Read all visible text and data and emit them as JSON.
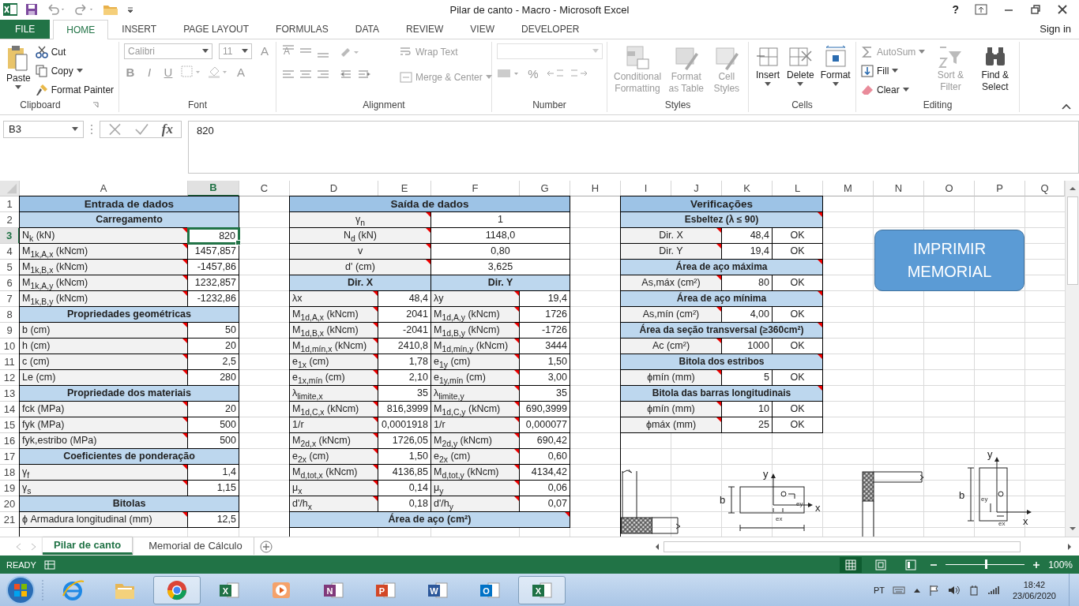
{
  "window": {
    "title": "Pilar de canto - Macro - Microsoft Excel",
    "help": "?"
  },
  "tabs": [
    {
      "label": "FILE",
      "kind": "file",
      "selected": false
    },
    {
      "label": "HOME",
      "kind": "tab",
      "selected": true
    },
    {
      "label": "INSERT",
      "kind": "tab",
      "selected": false
    },
    {
      "label": "PAGE LAYOUT",
      "kind": "tab",
      "selected": false
    },
    {
      "label": "FORMULAS",
      "kind": "tab",
      "selected": false
    },
    {
      "label": "DATA",
      "kind": "tab",
      "selected": false
    },
    {
      "label": "REVIEW",
      "kind": "tab",
      "selected": false
    },
    {
      "label": "VIEW",
      "kind": "tab",
      "selected": false
    },
    {
      "label": "DEVELOPER",
      "kind": "tab",
      "selected": false
    }
  ],
  "sign_in": "Sign in",
  "ribbon": {
    "clipboard": {
      "title": "Clipboard",
      "paste": "Paste",
      "cut": "Cut",
      "copy": "Copy",
      "format_painter": "Format Painter"
    },
    "font": {
      "title": "Font",
      "family": "Calibri",
      "size": "11",
      "bold": "B",
      "italic": "I",
      "underline": "U",
      "grow": "A",
      "shrink": "A",
      "paint_letter": "A",
      "disabled": true
    },
    "alignment": {
      "title": "Alignment",
      "wrap_text": "Wrap Text",
      "merge_center": "Merge & Center",
      "disabled": true
    },
    "number": {
      "title": "Number",
      "percent": "%",
      "disabled": true
    },
    "styles": {
      "title": "Styles",
      "conditional": "Conditional Formatting",
      "format_table": "Format as Table",
      "cell_styles": "Cell Styles",
      "disabled": true
    },
    "cells": {
      "title": "Cells",
      "insert": "Insert",
      "delete": "Delete",
      "format": "Format"
    },
    "editing": {
      "title": "Editing",
      "autosum": {
        "label": "AutoSum",
        "disabled": true
      },
      "fill": {
        "label": "Fill",
        "disabled": false
      },
      "clear": {
        "label": "Clear",
        "disabled": false
      },
      "sort_filter": {
        "label": "Sort & Filter",
        "disabled": true
      },
      "find_select": {
        "label": "Find & Select",
        "disabled": false
      }
    }
  },
  "formula_bar": {
    "name_box": "B3",
    "function_label": "fx",
    "value": "820"
  },
  "sheet": {
    "columns": [
      {
        "label": "A",
        "selected": false
      },
      {
        "label": "B",
        "selected": true
      },
      {
        "label": "C",
        "selected": false
      },
      {
        "label": "D",
        "selected": false
      },
      {
        "label": "E",
        "selected": false
      },
      {
        "label": "F",
        "selected": false
      },
      {
        "label": "G",
        "selected": false
      },
      {
        "label": "H",
        "selected": false
      },
      {
        "label": "I",
        "selected": false
      },
      {
        "label": "J",
        "selected": false
      },
      {
        "label": "K",
        "selected": false
      },
      {
        "label": "L",
        "selected": false
      },
      {
        "label": "M",
        "selected": false
      },
      {
        "label": "N",
        "selected": false
      },
      {
        "label": "O",
        "selected": false
      },
      {
        "label": "P",
        "selected": false
      },
      {
        "label": "Q",
        "selected": false
      }
    ],
    "rows": [
      {
        "label": "1",
        "selected": false
      },
      {
        "label": "2",
        "selected": false
      },
      {
        "label": "3",
        "selected": true
      },
      {
        "label": "4",
        "selected": false
      },
      {
        "label": "5",
        "selected": false
      },
      {
        "label": "6",
        "selected": false
      },
      {
        "label": "7",
        "selected": false
      },
      {
        "label": "8",
        "selected": false
      },
      {
        "label": "9",
        "selected": false
      },
      {
        "label": "10",
        "selected": false
      },
      {
        "label": "11",
        "selected": false
      },
      {
        "label": "12",
        "selected": false
      },
      {
        "label": "13",
        "selected": false
      },
      {
        "label": "14",
        "selected": false
      },
      {
        "label": "15",
        "selected": false
      },
      {
        "label": "16",
        "selected": false
      },
      {
        "label": "17",
        "selected": false
      },
      {
        "label": "18",
        "selected": false
      },
      {
        "label": "19",
        "selected": false
      },
      {
        "label": "20",
        "selected": false
      },
      {
        "label": "21",
        "selected": false
      }
    ]
  },
  "input": {
    "rows": [
      {
        "kind": "title",
        "text": "Entrada de dados"
      },
      {
        "kind": "section",
        "text": "Carregamento"
      },
      {
        "kind": "pair",
        "label": "N$_{k}$ (kN)",
        "value": "820",
        "note": true,
        "selected": true
      },
      {
        "kind": "pair",
        "label": "M$_{1k,A,x}$ (kNcm)",
        "value": "1457,857",
        "note": true,
        "selected": false
      },
      {
        "kind": "pair",
        "label": "M$_{1k,B,x}$ (kNcm)",
        "value": "-1457,86",
        "note": true,
        "selected": false
      },
      {
        "kind": "pair",
        "label": "M$_{1k,A,y}$ (kNcm)",
        "value": "1232,857",
        "note": true,
        "selected": false
      },
      {
        "kind": "pair",
        "label": "M$_{1k,B,y}$ (kNcm)",
        "value": "-1232,86",
        "note": true,
        "selected": false
      },
      {
        "kind": "section",
        "text": "Propriedades geométricas"
      },
      {
        "kind": "pair",
        "label": "b (cm)",
        "value": "50",
        "note": true,
        "selected": false
      },
      {
        "kind": "pair",
        "label": "h (cm)",
        "value": "20",
        "note": true,
        "selected": false
      },
      {
        "kind": "pair",
        "label": "c (cm)",
        "value": "2,5",
        "note": true,
        "selected": false
      },
      {
        "kind": "pair",
        "label": "Le (cm)",
        "value": "280",
        "note": true,
        "selected": false
      },
      {
        "kind": "section",
        "text": "Propriedade dos materiais"
      },
      {
        "kind": "pair",
        "label": "fck (MPa)",
        "value": "20",
        "note": true,
        "selected": false
      },
      {
        "kind": "pair",
        "label": "fyk (MPa)",
        "value": "500",
        "note": true,
        "selected": false
      },
      {
        "kind": "pair",
        "label": "fyk,estribo (MPa)",
        "value": "500",
        "note": true,
        "selected": false
      },
      {
        "kind": "section",
        "text": "Coeficientes de ponderação"
      },
      {
        "kind": "pair",
        "label": "γ$_{f}$",
        "value": "1,4",
        "note": true,
        "selected": false
      },
      {
        "kind": "pair",
        "label": "γ$_{s}$",
        "value": "1,15",
        "note": true,
        "selected": false
      },
      {
        "kind": "section",
        "text": "Bitolas"
      },
      {
        "kind": "pair",
        "label": "ϕ Armadura longitudinal (mm)",
        "value": "12,5",
        "note": true,
        "selected": false
      }
    ]
  },
  "output": {
    "rows": [
      {
        "kind": "title",
        "text": "Saída de dados"
      },
      {
        "kind": "pair",
        "label": "γ$_{n}$",
        "value": "1",
        "note": true
      },
      {
        "kind": "pair",
        "label": "N$_{d}$ (kN)",
        "value": "1148,0",
        "note": true
      },
      {
        "kind": "pair",
        "label": "v",
        "value": "0,80",
        "note": true
      },
      {
        "kind": "pair",
        "label": "d' (cm)",
        "value": "3,625",
        "note": true
      },
      {
        "kind": "heads",
        "labels": [
          "Dir. X",
          "Dir. Y"
        ]
      },
      {
        "kind": "quad",
        "left": {
          "label": "λx",
          "value": "48,4",
          "note": true
        },
        "right": {
          "label": "λy",
          "value": "19,4",
          "note": true
        }
      },
      {
        "kind": "quad",
        "left": {
          "label": "M$_{1d,A,x}$ (kNcm)",
          "value": "2041",
          "note": true
        },
        "right": {
          "label": "M$_{1d,A,y}$ (kNcm)",
          "value": "1726",
          "note": true
        }
      },
      {
        "kind": "quad",
        "left": {
          "label": "M$_{1d,B,x}$ (kNcm)",
          "value": "-2041",
          "note": true
        },
        "right": {
          "label": "M$_{1d,B,y}$ (kNcm)",
          "value": "-1726",
          "note": true
        }
      },
      {
        "kind": "quad",
        "left": {
          "label": "M$_{1d,mín,x}$ (kNcm)",
          "value": "2410,8",
          "note": true
        },
        "right": {
          "label": "M$_{1d,mín,y}$ (kNcm)",
          "value": "3444",
          "note": true
        }
      },
      {
        "kind": "quad",
        "left": {
          "label": "e$_{1x}$ (cm)",
          "value": "1,78",
          "note": true
        },
        "right": {
          "label": "e$_{1y}$ (cm)",
          "value": "1,50",
          "note": true
        }
      },
      {
        "kind": "quad",
        "left": {
          "label": "e$_{1x,mín}$ (cm)",
          "value": "2,10",
          "note": true
        },
        "right": {
          "label": "e$_{1y,mín}$ (cm)",
          "value": "3,00",
          "note": true
        }
      },
      {
        "kind": "quad",
        "left": {
          "label": "λ$_{limite,x}$",
          "value": "35",
          "note": true
        },
        "right": {
          "label": "λ$_{limite,y}$",
          "value": "35",
          "note": true
        }
      },
      {
        "kind": "quad",
        "left": {
          "label": "M$_{1d,C,x}$ (kNcm)",
          "value": "816,3999",
          "note": true
        },
        "right": {
          "label": "M$_{1d,C,y}$ (kNcm)",
          "value": "690,3999",
          "note": true
        }
      },
      {
        "kind": "quad",
        "left": {
          "label": "1/r",
          "value": "0,0001918",
          "note": true
        },
        "right": {
          "label": "1/r",
          "value": "0,000077",
          "note": true
        }
      },
      {
        "kind": "quad",
        "left": {
          "label": "M$_{2d,x}$ (kNcm)",
          "value": "1726,05",
          "note": true
        },
        "right": {
          "label": "M$_{2d,y}$ (kNcm)",
          "value": "690,42",
          "note": true
        }
      },
      {
        "kind": "quad",
        "left": {
          "label": "e$_{2x}$ (cm)",
          "value": "1,50",
          "note": true
        },
        "right": {
          "label": "e$_{2x}$ (cm)",
          "value": "0,60",
          "note": true
        }
      },
      {
        "kind": "quad",
        "left": {
          "label": "M$_{d,tot,x}$ (kNcm)",
          "value": "4136,85",
          "note": true
        },
        "right": {
          "label": "M$_{d,tot,y}$ (kNcm)",
          "value": "4134,42",
          "note": true
        }
      },
      {
        "kind": "quad",
        "left": {
          "label": "μ$_{x}$",
          "value": "0,14",
          "note": true
        },
        "right": {
          "label": "μ$_{y}$",
          "value": "0,06",
          "note": true
        }
      },
      {
        "kind": "quad",
        "left": {
          "label": "d'/h$_{x}$",
          "value": "0,18",
          "note": true
        },
        "right": {
          "label": "d'/h$_{y}$",
          "value": "0,07",
          "note": true
        }
      },
      {
        "kind": "section",
        "text": "Área de aço (cm²)",
        "note": true
      }
    ]
  },
  "checks": {
    "rows": [
      {
        "kind": "title",
        "text": "Verificações"
      },
      {
        "kind": "section",
        "text": "Esbeltez (λ ≤ 90)",
        "note": true
      },
      {
        "kind": "triple",
        "label": "Dir. X",
        "value": "48,4",
        "status": "OK",
        "note": true
      },
      {
        "kind": "triple",
        "label": "Dir. Y",
        "value": "19,4",
        "status": "OK",
        "note": true
      },
      {
        "kind": "section",
        "text": "Área de aço máxima",
        "note": true
      },
      {
        "kind": "triple",
        "label": "As,máx (cm²)",
        "value": "80",
        "status": "OK",
        "note": true
      },
      {
        "kind": "section",
        "text": "Área de aço mínima",
        "note": true
      },
      {
        "kind": "triple",
        "label": "As,mín (cm²)",
        "value": "4,00",
        "status": "OK",
        "note": true
      },
      {
        "kind": "section",
        "text": "Área da seção transversal (≥360cm²)",
        "note": true
      },
      {
        "kind": "triple",
        "label": "Ac (cm²)",
        "value": "1000",
        "status": "OK",
        "note": true
      },
      {
        "kind": "section",
        "text": "Bitola dos estribos",
        "note": true
      },
      {
        "kind": "triple",
        "label": "ϕmín (mm)",
        "value": "5",
        "status": "OK",
        "note": true
      },
      {
        "kind": "section",
        "text": "Bitola das barras longitudinais",
        "note": true
      },
      {
        "kind": "triple",
        "label": "ϕmín (mm)",
        "value": "10",
        "status": "OK",
        "note": true
      },
      {
        "kind": "triple",
        "label": "ϕmáx (mm)",
        "value": "25",
        "status": "OK",
        "note": true
      }
    ]
  },
  "print_button": "IMPRIMIR MEMORIAL",
  "diagrams": [
    {
      "kind": "l-frame"
    },
    {
      "kind": "section-wide",
      "labels": {
        "y": "y",
        "x": "x",
        "b": "b",
        "ex": "ex",
        "ey": "ey"
      }
    },
    {
      "kind": "beam-column"
    },
    {
      "kind": "section-tall",
      "labels": {
        "y": "y",
        "x": "x",
        "b": "b",
        "ex": "ex",
        "ey": "ey"
      }
    }
  ],
  "sheet_tabs": [
    {
      "label": "Pilar de canto",
      "selected": true
    },
    {
      "label": "Memorial de Cálculo",
      "selected": false
    }
  ],
  "status": {
    "ready": "READY",
    "zoom": "100%",
    "slider": {
      "level": 0.5
    }
  },
  "taskbar": {
    "items": [
      {
        "kind": "browser",
        "selected": false
      },
      {
        "kind": "folder",
        "selected": false
      },
      {
        "kind": "globe",
        "selected": true
      },
      {
        "kind": "tile",
        "letter": "X",
        "color": "#1e7145",
        "selected": false
      },
      {
        "kind": "player",
        "selected": false
      },
      {
        "kind": "tile",
        "letter": "N",
        "color": "#80397b",
        "selected": false
      },
      {
        "kind": "tile",
        "letter": "P",
        "color": "#d24726",
        "selected": false
      },
      {
        "kind": "tile",
        "letter": "W",
        "color": "#2b579a",
        "selected": false
      },
      {
        "kind": "tile",
        "letter": "O",
        "color": "#0072c6",
        "selected": false
      },
      {
        "kind": "tile",
        "letter": "X",
        "color": "#1e7145",
        "selected": true
      }
    ],
    "language": "PT",
    "time": "18:42",
    "date": "23/06/2020"
  }
}
